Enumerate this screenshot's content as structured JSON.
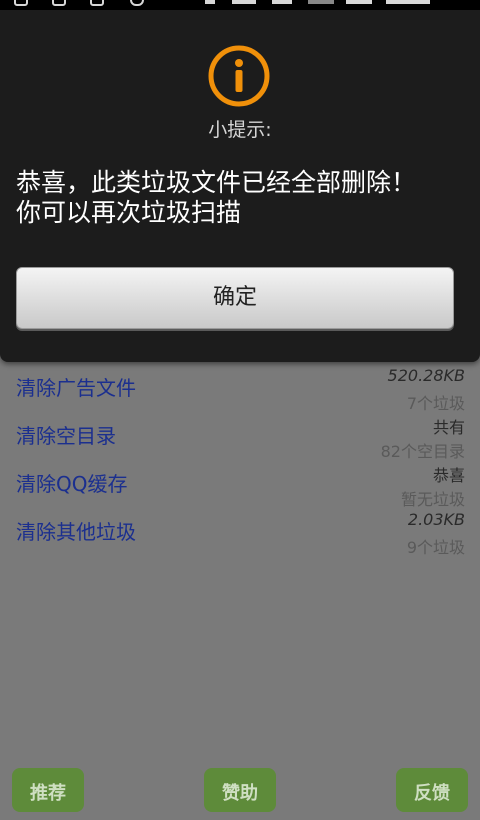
{
  "dialog": {
    "icon": "info-icon",
    "title": "小提示:",
    "message": "恭喜，此类垃圾文件已经全部删除！你可以再次垃圾扫描",
    "ok_label": "确定"
  },
  "list": {
    "items": [
      {
        "label": "清除广告文件",
        "value": "520.28KB",
        "sub": "7个垃圾"
      },
      {
        "label": "清除空目录",
        "value": "共有",
        "sub": "82个空目录"
      },
      {
        "label": "清除QQ缓存",
        "value": "恭喜",
        "sub": "暂无垃圾"
      },
      {
        "label": "清除其他垃圾",
        "value": "2.03KB",
        "sub": "9个垃圾"
      }
    ]
  },
  "bottom": {
    "recommend_label": "推荐",
    "sponsor_label": "赞助",
    "feedback_label": "反馈"
  },
  "colors": {
    "accent_icon": "#f0900a",
    "dialog_bg": "#1c1c1c",
    "link_text": "#1b2f8f",
    "button_green": "#5e8b3a"
  }
}
